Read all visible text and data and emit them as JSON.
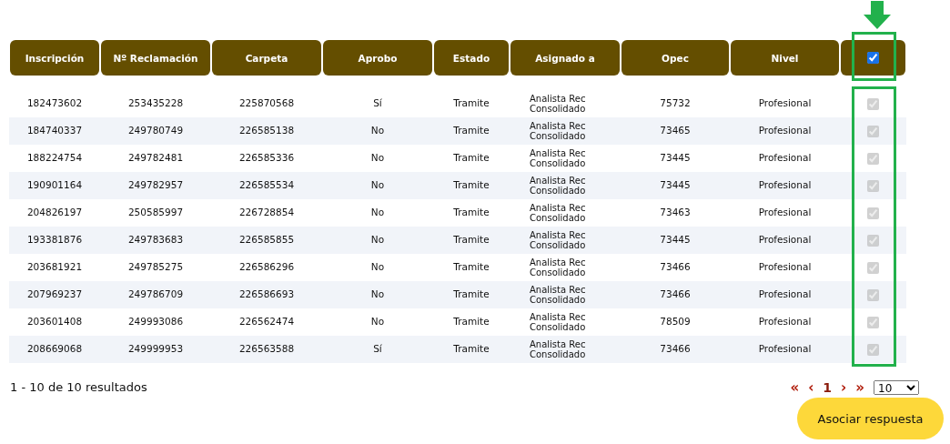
{
  "table": {
    "columns": [
      "Inscripción",
      "Nº Reclamación",
      "Carpeta",
      "Aprobo",
      "Estado",
      "Asignado a",
      "Opec",
      "Nivel"
    ],
    "select_all": {
      "checked": true
    },
    "rows": [
      {
        "cells": [
          "182473602",
          "253435228",
          "225870568",
          "Sí",
          "Tramite",
          "Analista Rec Consolidado",
          "75732",
          "Profesional"
        ],
        "checked": true,
        "disabled": true
      },
      {
        "cells": [
          "184740337",
          "249780749",
          "226585138",
          "No",
          "Tramite",
          "Analista Rec Consolidado",
          "73465",
          "Profesional"
        ],
        "checked": true,
        "disabled": true
      },
      {
        "cells": [
          "188224754",
          "249782481",
          "226585336",
          "No",
          "Tramite",
          "Analista Rec Consolidado",
          "73445",
          "Profesional"
        ],
        "checked": true,
        "disabled": true
      },
      {
        "cells": [
          "190901164",
          "249782957",
          "226585534",
          "No",
          "Tramite",
          "Analista Rec Consolidado",
          "73445",
          "Profesional"
        ],
        "checked": true,
        "disabled": true
      },
      {
        "cells": [
          "204826197",
          "250585997",
          "226728854",
          "No",
          "Tramite",
          "Analista Rec Consolidado",
          "73463",
          "Profesional"
        ],
        "checked": true,
        "disabled": true
      },
      {
        "cells": [
          "193381876",
          "249783683",
          "226585855",
          "No",
          "Tramite",
          "Analista Rec Consolidado",
          "73445",
          "Profesional"
        ],
        "checked": true,
        "disabled": true
      },
      {
        "cells": [
          "203681921",
          "249785275",
          "226586296",
          "No",
          "Tramite",
          "Analista Rec Consolidado",
          "73466",
          "Profesional"
        ],
        "checked": true,
        "disabled": true
      },
      {
        "cells": [
          "207969237",
          "249786709",
          "226586693",
          "No",
          "Tramite",
          "Analista Rec Consolidado",
          "73466",
          "Profesional"
        ],
        "checked": true,
        "disabled": true
      },
      {
        "cells": [
          "203601408",
          "249993086",
          "226562474",
          "No",
          "Tramite",
          "Analista Rec Consolidado",
          "78509",
          "Profesional"
        ],
        "checked": true,
        "disabled": true
      },
      {
        "cells": [
          "208669068",
          "249999953",
          "226563588",
          "Sí",
          "Tramite",
          "Analista Rec Consolidado",
          "73466",
          "Profesional"
        ],
        "checked": true,
        "disabled": true
      }
    ]
  },
  "footer": {
    "results": "1 - 10 de 10 resultados",
    "pagination": {
      "first": "«",
      "prev": "‹",
      "current": "1",
      "next": "›",
      "last": "»"
    },
    "page_size": "10"
  },
  "action_button": "Asociar respuesta"
}
